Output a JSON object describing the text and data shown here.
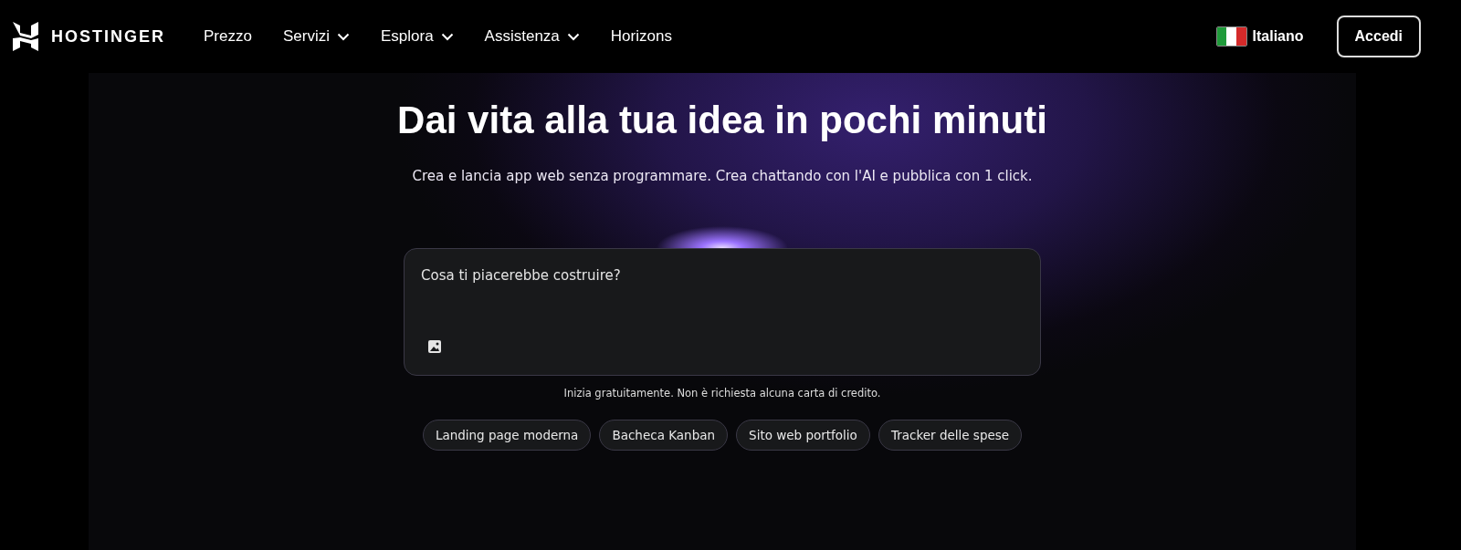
{
  "header": {
    "logo": "HOSTINGER",
    "nav": [
      {
        "label": "Prezzo",
        "dropdown": false
      },
      {
        "label": "Servizi",
        "dropdown": true
      },
      {
        "label": "Esplora",
        "dropdown": true
      },
      {
        "label": "Assistenza",
        "dropdown": true
      },
      {
        "label": "Horizons",
        "dropdown": false
      }
    ],
    "language": "Italiano",
    "login": "Accedi"
  },
  "hero": {
    "title": "Dai vita alla tua idea in pochi minuti",
    "subtitle": "Crea e lancia app web senza programmare. Crea chattando con l'AI e pubblica con 1 click.",
    "prompt": {
      "placeholder": "Cosa ti piacerebbe costruire?"
    },
    "note": "Inizia gratuitamente. Non è richiesta alcuna carta di credito.",
    "suggestions": [
      "Landing page moderna",
      "Bacheca Kanban",
      "Sito web portfolio",
      "Tracker delle spese"
    ]
  }
}
